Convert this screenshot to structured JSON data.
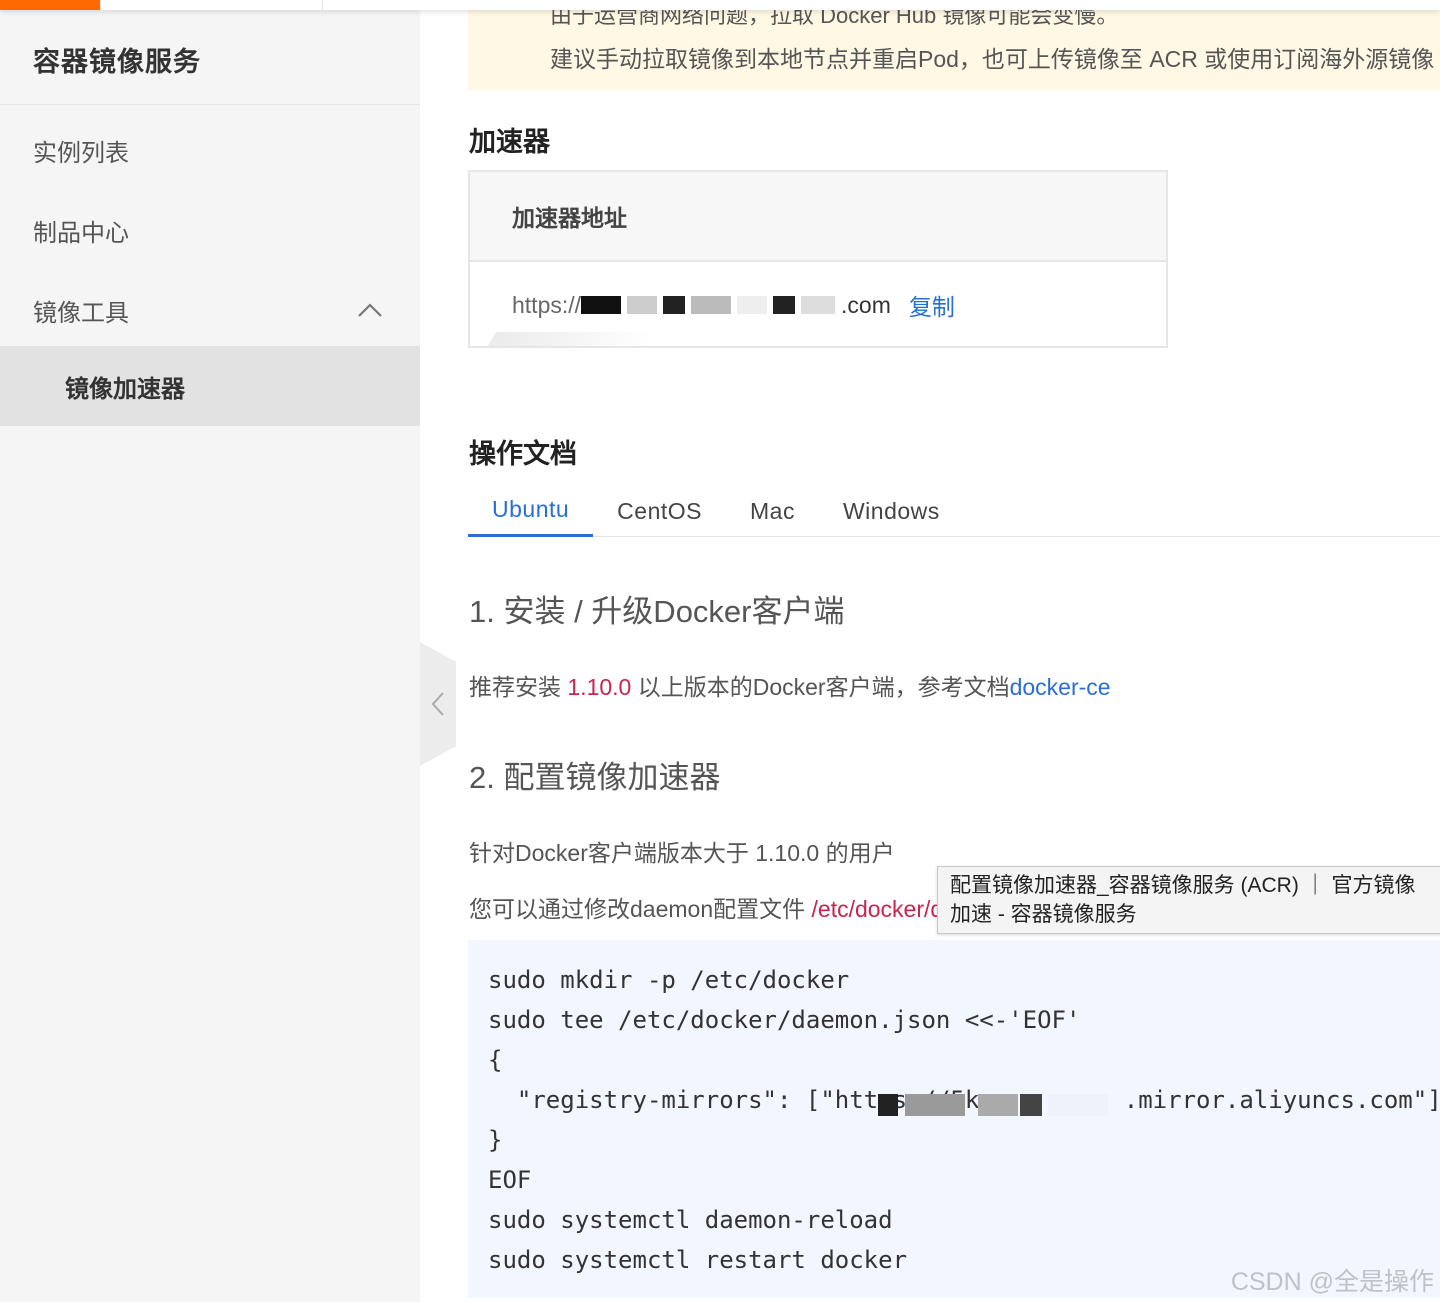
{
  "sidebar": {
    "title": "容器镜像服务",
    "items": [
      {
        "label": "实例列表"
      },
      {
        "label": "制品中心"
      },
      {
        "label": "镜像工具",
        "expanded": true
      },
      {
        "label": "镜像加速器",
        "active": true
      }
    ],
    "collapse_icon": "chevron-left-icon"
  },
  "notice": {
    "line1": "由于运营商网络问题，拉取 Docker Hub 镜像可能会变慢。",
    "line2": "建议手动拉取镜像到本地节点并重启Pod，也可上传镜像至 ACR 或使用订阅海外源镜像"
  },
  "accelerator": {
    "heading": "加速器",
    "table_header": "加速器地址",
    "url_start": "https://",
    "url_end": ".com",
    "copy_label": "复制"
  },
  "docs": {
    "heading": "操作文档",
    "tabs": [
      "Ubuntu",
      "CentOS",
      "Mac",
      "Windows"
    ],
    "active_tab": "Ubuntu",
    "step1_title": "1. 安装 / 升级Docker客户端",
    "step1_text_a": "推荐安装 ",
    "step1_version": "1.10.0",
    "step1_text_b": " 以上版本的Docker客户端，参考文档",
    "step1_link": "docker-ce",
    "step2_title": "2. 配置镜像加速器",
    "step2_text1": "针对Docker客户端版本大于 1.10.0 的用户",
    "step2_text2_a": "您可以通过修改daemon配置文件 ",
    "step2_text2_path": "/etc/docker/daemon.json"
  },
  "tooltip": {
    "line1": "配置镜像加速器_容器镜像服务 (ACR) ｜ 官方镜像",
    "line2": "加速 - 容器镜像服务"
  },
  "code": {
    "lines": [
      "sudo mkdir -p /etc/docker",
      "sudo tee /etc/docker/daemon.json <<-'EOF'",
      "{",
      "  \"registry-mirrors\": [\"https://5km         .mirror.aliyuncs.com\"]",
      "}",
      "EOF",
      "sudo systemctl daemon-reload",
      "sudo systemctl restart docker"
    ]
  },
  "watermark": "CSDN @全是操作",
  "colors": {
    "accent_orange": "#ff6a00",
    "link_blue": "#2a6ed4",
    "highlight_red": "#c7254e",
    "notice_bg": "#fff8e4",
    "code_bg": "#f2f6fe",
    "sidebar_bg": "#f5f5f5"
  }
}
